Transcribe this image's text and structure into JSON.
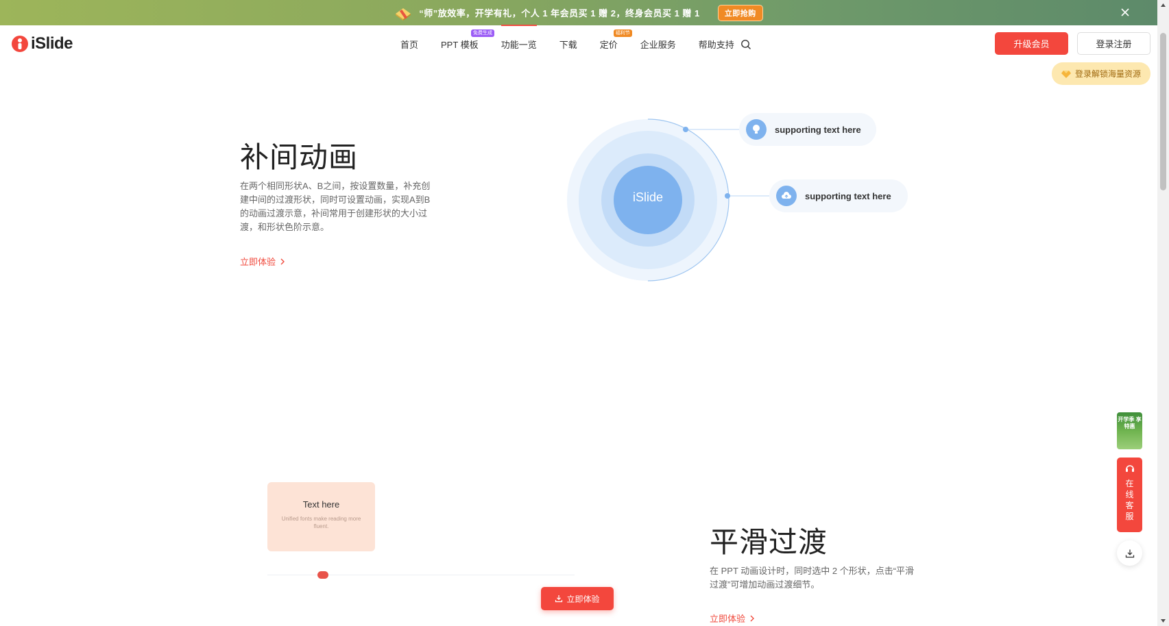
{
  "promo": {
    "text": "“师”放效率，开学有礼，个人 1 年会员买 1 赠 2，终身会员买 1 赠 1",
    "cta": "立即抢购",
    "icon": "gift-icon"
  },
  "header": {
    "logo_text": "iSlide",
    "nav": [
      {
        "label": "首页"
      },
      {
        "label": "PPT 模板",
        "badge": "免费生成",
        "badge_color": "#9b5cf6"
      },
      {
        "label": "功能一览",
        "active": true
      },
      {
        "label": "下载"
      },
      {
        "label": "定价",
        "badge": "福利节",
        "badge_color": "#f08a24"
      },
      {
        "label": "企业服务"
      },
      {
        "label": "帮助支持"
      }
    ],
    "upgrade_label": "升级会员",
    "login_label": "登录注册",
    "unlock_tip": "登录解锁海量资源"
  },
  "section1": {
    "title": "补间动画",
    "description": "在两个相同形状A、B之间，按设置数量，补充创建中间的过渡形状，同时可设置动画，实现A到B的动画过渡示意，补间常用于创建形状的大小过渡，和形状色阶示意。",
    "link": "立即体验",
    "diagram": {
      "center_label": "iSlide",
      "items": [
        {
          "text": "supporting text here",
          "icon": "lightbulb-icon"
        },
        {
          "text": "supporting text here",
          "icon": "cloud-upload-icon"
        }
      ]
    }
  },
  "section2": {
    "card_title": "Text here",
    "card_subtitle": "Unified fonts make reading more fluent.",
    "cta": "立即体验",
    "title": "平滑过渡",
    "description": "在 PPT 动画设计时，同时选中 2 个形状，点击“平滑过渡”可增加动画过渡细节。",
    "link": "立即体验"
  },
  "side": {
    "promo_text": "开学季 享特惠",
    "service_label": [
      "在",
      "线",
      "客",
      "服"
    ]
  },
  "colors": {
    "accent": "#f3473d",
    "diagram_blue": "#7eb2ee"
  }
}
